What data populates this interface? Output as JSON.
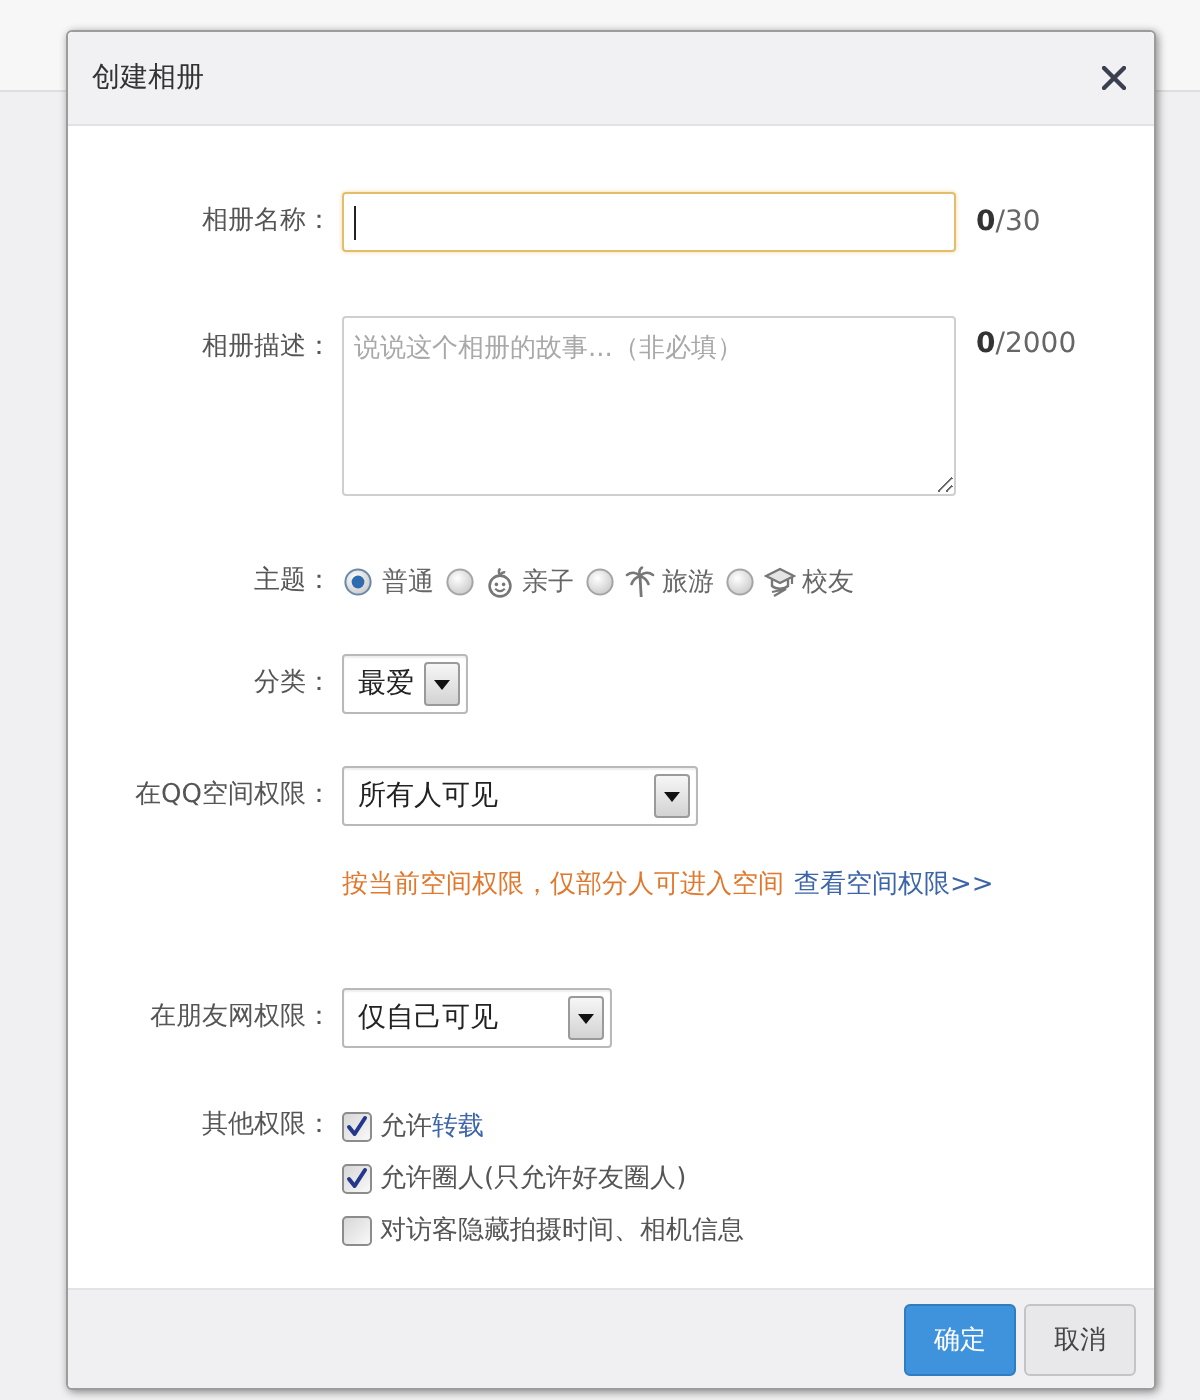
{
  "dialog": {
    "title": "创建相册"
  },
  "form": [
    {
      "kind": "text",
      "label": "相册名称：",
      "focused": true,
      "counter": "**0**/30"
    },
    {
      "kind": "textarea",
      "label": "相册描述：",
      "placeholder": "说说这个相册的故事...（非必填）",
      "counter": "**0**/2000"
    },
    {
      "kind": "radio",
      "label": "主题：",
      "options": [
        {
          "label": "普通",
          "selected": true
        },
        {
          "label": "亲子",
          "selected": false
        },
        {
          "label": "旅游",
          "selected": false
        },
        {
          "label": "校友",
          "selected": false
        }
      ]
    },
    {
      "kind": "select",
      "label": "分类：",
      "value": "最爱"
    },
    {
      "kind": "select",
      "label": "在QQ空间权限：",
      "value": "所有人可见",
      "note": "按当前空间权限，仅部分人可进入空间",
      "link": "查看空间权限>>"
    },
    {
      "kind": "select",
      "label": "在朋友网权限：",
      "value": "仅自己可见"
    },
    {
      "kind": "checkbox",
      "label": "其他权限：",
      "options": [
        {
          "label": "允许",
          "link": "转载",
          "checked": true
        },
        {
          "label": "允许圈人(只允许好友圈人)",
          "checked": true
        },
        {
          "label": "对访客隐藏拍摄时间、相机信息",
          "checked": false
        }
      ]
    }
  ],
  "buttons": [
    {
      "label": "确定",
      "kind": "primary"
    },
    {
      "label": "取消",
      "kind": "secondary"
    }
  ]
}
